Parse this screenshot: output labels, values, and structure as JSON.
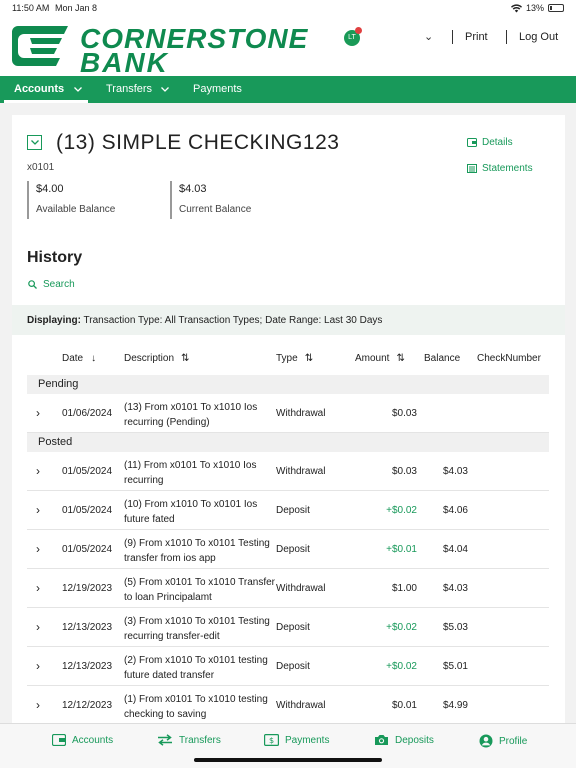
{
  "status_bar": {
    "time": "11:50 AM",
    "date": "Mon Jan 8",
    "battery": "13%"
  },
  "header": {
    "logo_line1": "CORNERSTONE",
    "logo_line2": "BANK",
    "user_initials": "LT",
    "print_label": "Print",
    "logout_label": "Log Out"
  },
  "nav": {
    "items": [
      {
        "label": "Accounts",
        "active": true,
        "has_dropdown": true
      },
      {
        "label": "Transfers",
        "active": false,
        "has_dropdown": true
      },
      {
        "label": "Payments",
        "active": false,
        "has_dropdown": false
      }
    ]
  },
  "account": {
    "name": "(13) SIMPLE CHECKING123",
    "number": "x0101",
    "available_balance": "$4.00",
    "available_label": "Available Balance",
    "current_balance": "$4.03",
    "current_label": "Current Balance",
    "details_label": "Details",
    "statements_label": "Statements"
  },
  "history": {
    "title": "History",
    "search_label": "Search",
    "displaying_label": "Displaying:",
    "displaying_value": "Transaction Type: All Transaction Types; Date Range: Last 30 Days",
    "columns": [
      "Date",
      "Description",
      "Type",
      "Amount",
      "Balance",
      "CheckNumber"
    ],
    "pending_label": "Pending",
    "posted_label": "Posted",
    "pending": [
      {
        "date": "01/06/2024",
        "desc": "(13) From x0101 To x1010 Ios recurring (Pending)",
        "type": "Withdrawal",
        "amount": "$0.03",
        "balance": ""
      }
    ],
    "posted": [
      {
        "date": "01/05/2024",
        "desc": "(11) From x0101 To x1010 Ios recurring",
        "type": "Withdrawal",
        "amount": "$0.03",
        "balance": "$4.03"
      },
      {
        "date": "01/05/2024",
        "desc": "(10) From x1010 To x0101 Ios future fated",
        "type": "Deposit",
        "amount": "+$0.02",
        "balance": "$4.06"
      },
      {
        "date": "01/05/2024",
        "desc": "(9) From x1010 To x0101 Testing transfer from ios app",
        "type": "Deposit",
        "amount": "+$0.01",
        "balance": "$4.04"
      },
      {
        "date": "12/19/2023",
        "desc": "(5) From x0101 To x1010 Transfer to loan Principalamt",
        "type": "Withdrawal",
        "amount": "$1.00",
        "balance": "$4.03"
      },
      {
        "date": "12/13/2023",
        "desc": "(3) From x1010 To x0101 Testing recurring transfer-edit",
        "type": "Deposit",
        "amount": "+$0.02",
        "balance": "$5.03"
      },
      {
        "date": "12/13/2023",
        "desc": "(2) From x1010 To x0101 testing future dated transfer",
        "type": "Deposit",
        "amount": "+$0.02",
        "balance": "$5.01"
      },
      {
        "date": "12/12/2023",
        "desc": "(1) From x0101 To x1010 testing checking to saving",
        "type": "Withdrawal",
        "amount": "$0.01",
        "balance": "$4.99"
      }
    ]
  },
  "tabbar": {
    "items": [
      {
        "label": "Accounts",
        "icon": "wallet-icon"
      },
      {
        "label": "Transfers",
        "icon": "transfer-arrows-icon"
      },
      {
        "label": "Payments",
        "icon": "dollar-bill-icon"
      },
      {
        "label": "Deposits",
        "icon": "camera-icon"
      },
      {
        "label": "Profile",
        "icon": "user-circle-icon"
      }
    ]
  },
  "colors": {
    "brand_green": "#18995a",
    "deposit_green": "#18995a"
  }
}
